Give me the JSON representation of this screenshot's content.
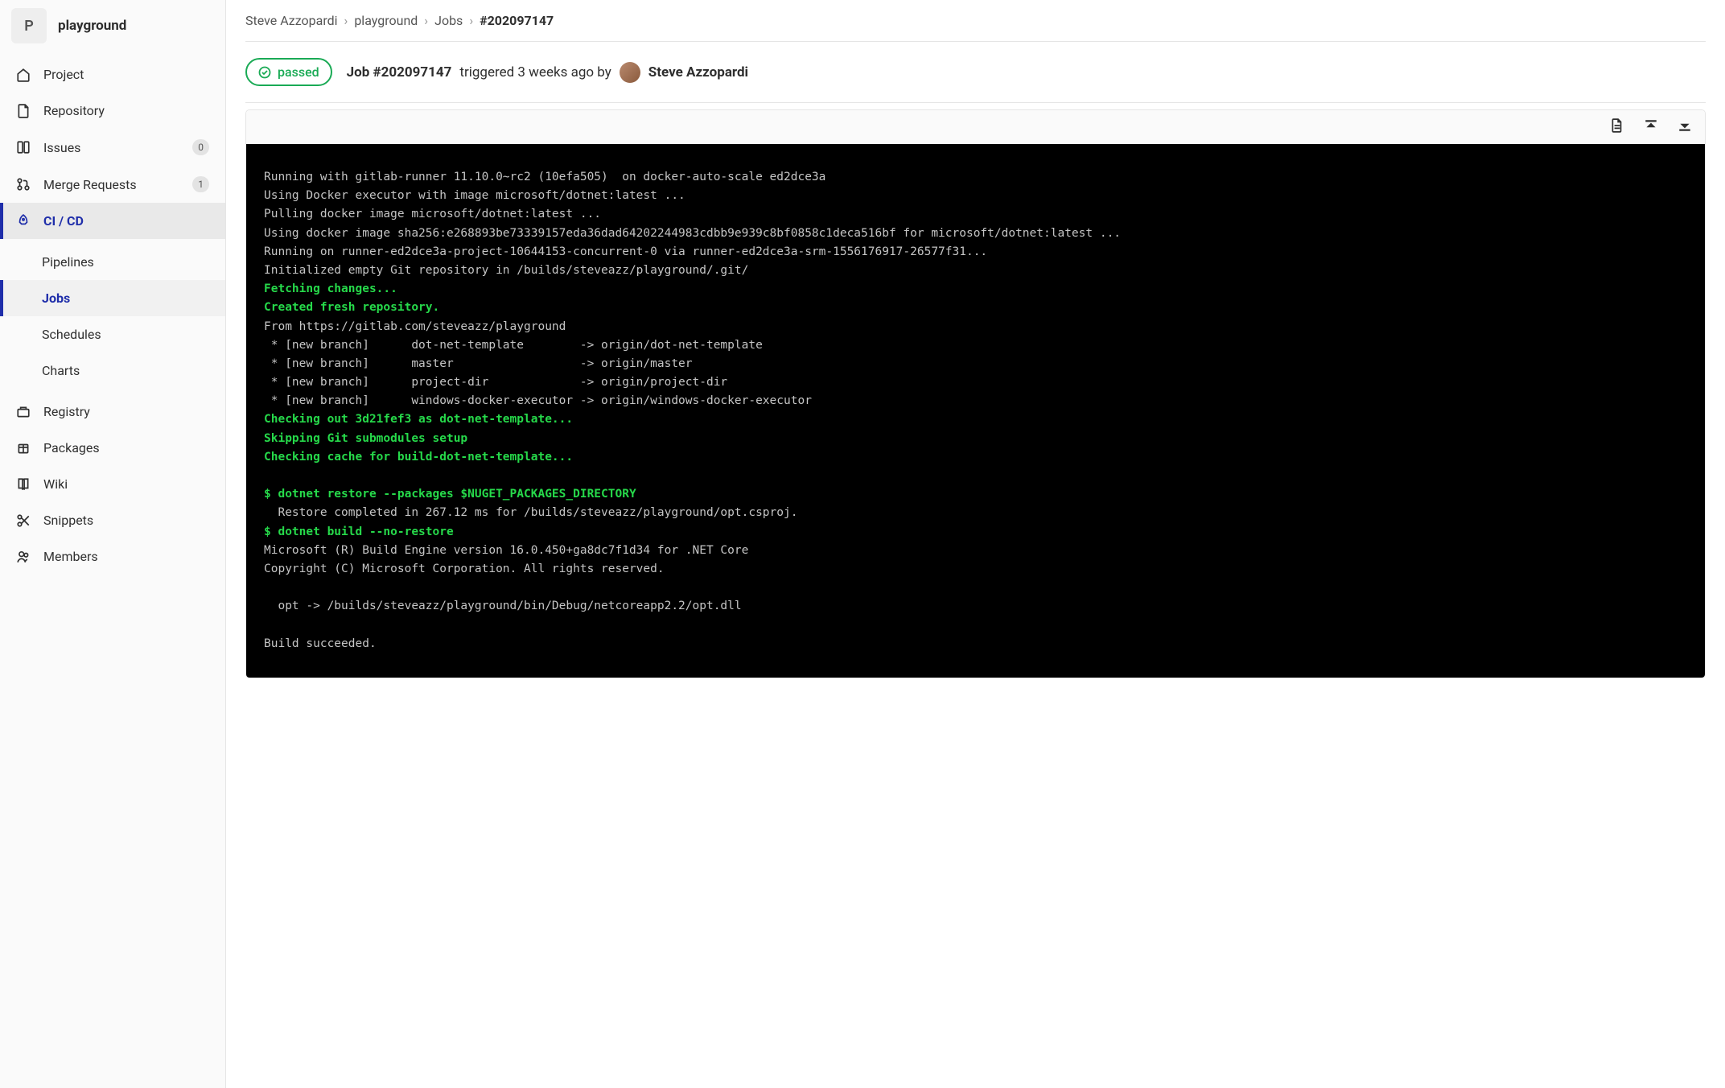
{
  "project": {
    "avatar_letter": "P",
    "name": "playground"
  },
  "sidebar": {
    "items": [
      {
        "icon": "home",
        "label": "Project"
      },
      {
        "icon": "file",
        "label": "Repository"
      },
      {
        "icon": "issues",
        "label": "Issues",
        "badge": "0"
      },
      {
        "icon": "merge",
        "label": "Merge Requests",
        "badge": "1"
      },
      {
        "icon": "rocket",
        "label": "CI / CD",
        "active": true
      },
      {
        "icon": "registry",
        "label": "Registry"
      },
      {
        "icon": "package",
        "label": "Packages"
      },
      {
        "icon": "book",
        "label": "Wiki"
      },
      {
        "icon": "scissors",
        "label": "Snippets"
      },
      {
        "icon": "members",
        "label": "Members"
      }
    ],
    "cicd_sub": [
      {
        "label": "Pipelines"
      },
      {
        "label": "Jobs",
        "active": true
      },
      {
        "label": "Schedules"
      },
      {
        "label": "Charts"
      }
    ]
  },
  "breadcrumb": {
    "parts": [
      "Steve Azzopardi",
      "playground",
      "Jobs"
    ],
    "current": "#202097147"
  },
  "job": {
    "status": "passed",
    "title_prefix": "Job #202097147",
    "title_mid": " triggered 3 weeks ago by ",
    "author": "Steve Azzopardi"
  },
  "log": {
    "lines": [
      {
        "t": "Running with gitlab-runner 11.10.0~rc2 (10efa505)  on docker-auto-scale ed2dce3a"
      },
      {
        "t": "Using Docker executor with image microsoft/dotnet:latest ..."
      },
      {
        "t": "Pulling docker image microsoft/dotnet:latest ..."
      },
      {
        "t": "Using docker image sha256:e268893be73339157eda36dad64202244983cdbb9e939c8bf0858c1deca516bf for microsoft/dotnet:latest ..."
      },
      {
        "t": "Running on runner-ed2dce3a-project-10644153-concurrent-0 via runner-ed2dce3a-srm-1556176917-26577f31..."
      },
      {
        "t": "Initialized empty Git repository in /builds/steveazz/playground/.git/"
      },
      {
        "c": "gb",
        "t": "Fetching changes..."
      },
      {
        "c": "gb",
        "t": "Created fresh repository."
      },
      {
        "t": "From https://gitlab.com/steveazz/playground"
      },
      {
        "t": " * [new branch]      dot-net-template        -> origin/dot-net-template"
      },
      {
        "t": " * [new branch]      master                  -> origin/master"
      },
      {
        "t": " * [new branch]      project-dir             -> origin/project-dir"
      },
      {
        "t": " * [new branch]      windows-docker-executor -> origin/windows-docker-executor"
      },
      {
        "c": "gb",
        "t": "Checking out 3d21fef3 as dot-net-template..."
      },
      {
        "c": "gb",
        "t": "Skipping Git submodules setup"
      },
      {
        "c": "gb",
        "t": "Checking cache for build-dot-net-template..."
      },
      {
        "t": ""
      },
      {
        "c": "gb",
        "t": "$ dotnet restore --packages $NUGET_PACKAGES_DIRECTORY"
      },
      {
        "t": "  Restore completed in 267.12 ms for /builds/steveazz/playground/opt.csproj."
      },
      {
        "c": "gb",
        "t": "$ dotnet build --no-restore"
      },
      {
        "t": "Microsoft (R) Build Engine version 16.0.450+ga8dc7f1d34 for .NET Core"
      },
      {
        "t": "Copyright (C) Microsoft Corporation. All rights reserved."
      },
      {
        "t": ""
      },
      {
        "t": "  opt -> /builds/steveazz/playground/bin/Debug/netcoreapp2.2/opt.dll"
      },
      {
        "t": ""
      },
      {
        "t": "Build succeeded."
      }
    ]
  }
}
